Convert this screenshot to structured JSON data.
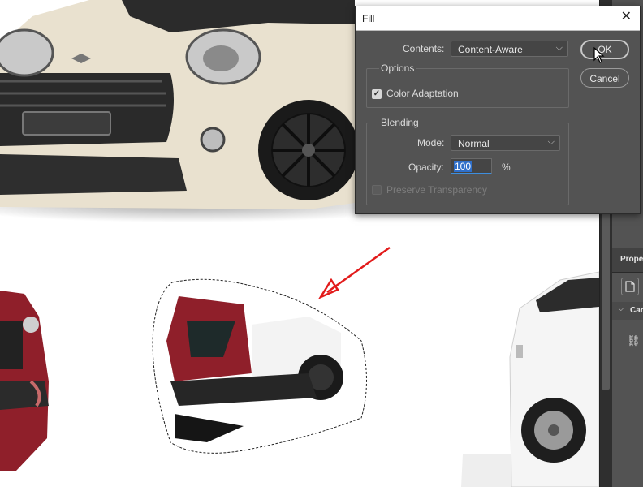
{
  "dialog": {
    "title": "Fill",
    "contents_label": "Contents:",
    "contents_value": "Content-Aware",
    "options_title": "Options",
    "color_adaptation_label": "Color Adaptation",
    "color_adaptation_checked": true,
    "blending_title": "Blending",
    "mode_label": "Mode:",
    "mode_value": "Normal",
    "opacity_label": "Opacity:",
    "opacity_value": "100",
    "opacity_unit": "%",
    "preserve_transparency_label": "Preserve Transparency",
    "preserve_transparency_checked": false,
    "ok_label": "OK",
    "cancel_label": "Cancel"
  },
  "right_panel": {
    "properties_title": "Prope",
    "canvas_label": "Car"
  },
  "colors": {
    "dialog_bg": "#535353",
    "accent": "#2f6fc9",
    "annotation_arrow": "#e21b1b",
    "car_red": "#8f1f2a",
    "car_cream": "#e9e1cf"
  },
  "icons": [
    "close-icon",
    "chevron-down-icon",
    "checkmark-icon",
    "document-icon",
    "link-icon",
    "mouse-cursor-icon",
    "red-arrow-annotation"
  ]
}
